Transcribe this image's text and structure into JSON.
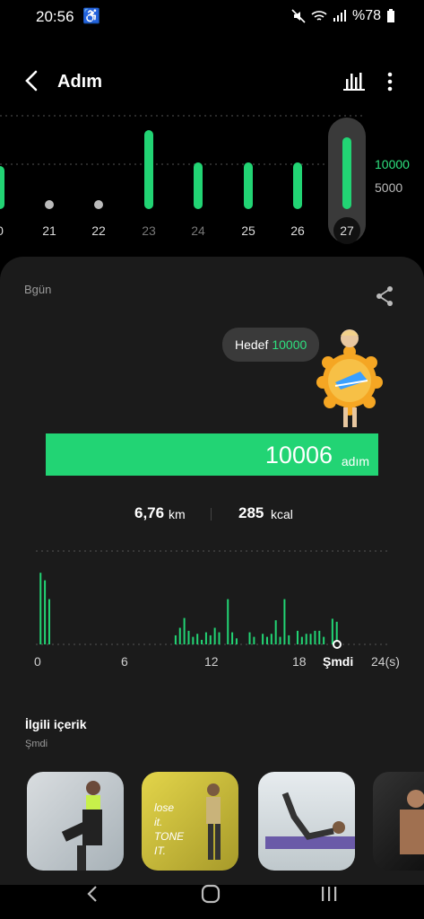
{
  "status": {
    "time": "20:56",
    "battery": "%78"
  },
  "header": {
    "title": "Adım"
  },
  "week_chart": {
    "goal_label": "10000",
    "mid_label": "5000",
    "days": [
      {
        "label": "0",
        "steps": 6000
      },
      {
        "label": "21",
        "steps": 1200
      },
      {
        "label": "22",
        "steps": 400
      },
      {
        "label": "23",
        "steps": 11000
      },
      {
        "label": "24",
        "steps": 6500
      },
      {
        "label": "25",
        "steps": 6500
      },
      {
        "label": "26",
        "steps": 6500
      },
      {
        "label": "27",
        "steps": 10006
      }
    ],
    "selected": "27"
  },
  "card": {
    "period": "Bgün",
    "goal_prefix": "Hedef",
    "goal_value": "10000",
    "steps_value": "10006",
    "steps_unit": "adım",
    "distance_value": "6,76",
    "distance_unit": "km",
    "calories_value": "285",
    "calories_unit": "kcal"
  },
  "day_chart": {
    "x_labels": [
      "0",
      "6",
      "12",
      "18",
      "Şmdi",
      "24(s)"
    ],
    "bars": [
      {
        "hour": 0.2,
        "v": 0.95
      },
      {
        "hour": 0.5,
        "v": 0.85
      },
      {
        "hour": 0.8,
        "v": 0.6
      },
      {
        "hour": 9.5,
        "v": 0.12
      },
      {
        "hour": 9.8,
        "v": 0.22
      },
      {
        "hour": 10.1,
        "v": 0.35
      },
      {
        "hour": 10.4,
        "v": 0.18
      },
      {
        "hour": 10.7,
        "v": 0.1
      },
      {
        "hour": 11.0,
        "v": 0.14
      },
      {
        "hour": 11.3,
        "v": 0.06
      },
      {
        "hour": 11.6,
        "v": 0.16
      },
      {
        "hour": 11.9,
        "v": 0.12
      },
      {
        "hour": 12.2,
        "v": 0.22
      },
      {
        "hour": 12.5,
        "v": 0.16
      },
      {
        "hour": 13.1,
        "v": 0.6
      },
      {
        "hour": 13.4,
        "v": 0.16
      },
      {
        "hour": 13.7,
        "v": 0.08
      },
      {
        "hour": 14.6,
        "v": 0.16
      },
      {
        "hour": 14.9,
        "v": 0.1
      },
      {
        "hour": 15.5,
        "v": 0.14
      },
      {
        "hour": 15.8,
        "v": 0.1
      },
      {
        "hour": 16.1,
        "v": 0.14
      },
      {
        "hour": 16.4,
        "v": 0.32
      },
      {
        "hour": 16.7,
        "v": 0.1
      },
      {
        "hour": 17.0,
        "v": 0.6
      },
      {
        "hour": 17.3,
        "v": 0.12
      },
      {
        "hour": 17.9,
        "v": 0.18
      },
      {
        "hour": 18.2,
        "v": 0.1
      },
      {
        "hour": 18.5,
        "v": 0.14
      },
      {
        "hour": 18.8,
        "v": 0.14
      },
      {
        "hour": 19.1,
        "v": 0.18
      },
      {
        "hour": 19.4,
        "v": 0.18
      },
      {
        "hour": 19.7,
        "v": 0.1
      },
      {
        "hour": 20.3,
        "v": 0.34
      },
      {
        "hour": 20.6,
        "v": 0.3
      }
    ]
  },
  "related": {
    "title": "İlgili içerik",
    "subtitle": "Şmdi",
    "items": [
      "workout-photo-1",
      "lose it. TONE IT.",
      "workout-photo-3",
      "workout-photo-4"
    ]
  },
  "colors": {
    "accent": "#22d474",
    "card": "#1b1b1b"
  }
}
